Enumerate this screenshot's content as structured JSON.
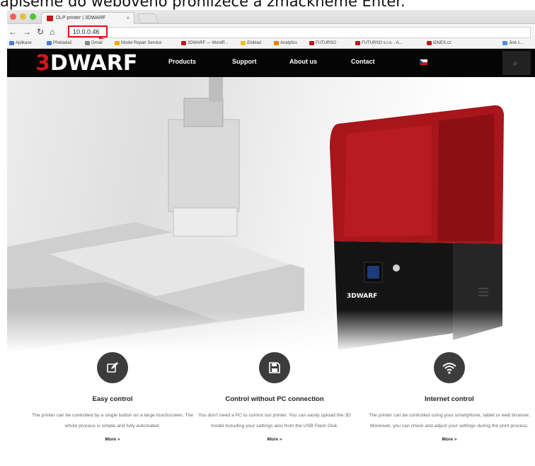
{
  "caption": "apíšeme do webového prohlížeče a zmáčkneme Enter.",
  "browser": {
    "tab_title": "DLP printer | 3DWARF",
    "tab_close": "×",
    "url": "10.0.0.46",
    "bookmarks": [
      {
        "label": "Aplikace",
        "color": "#4a7bd5"
      },
      {
        "label": "Překladač",
        "color": "#4a7bd5"
      },
      {
        "label": "Gmail",
        "color": "#888888"
      },
      {
        "label": "Model Repair Service",
        "color": "#f2a900"
      },
      {
        "label": "3DWARF — WordP...",
        "color": "#c0161c"
      },
      {
        "label": "iDoklad",
        "color": "#f0c419"
      },
      {
        "label": "Analytics",
        "color": "#f07d00"
      },
      {
        "label": "FUTURSO",
        "color": "#c0161c"
      },
      {
        "label": "FUTURSO s.r.o. - A...",
        "color": "#c0161c"
      },
      {
        "label": "iDNES.cz",
        "color": "#c0161c"
      },
      {
        "label": "Jiné z...",
        "color": "#4a90d9"
      }
    ]
  },
  "site": {
    "logo_prefix": "3",
    "logo_rest": "DWARF",
    "nav": [
      "Products",
      "Support",
      "About us",
      "Contact"
    ],
    "printer_label": "3DWARF",
    "colors": {
      "accent": "#d7131a",
      "nav_bg": "#050505"
    }
  },
  "features": [
    {
      "icon": "edit-icon",
      "title": "Easy control",
      "desc": "The printer can be controlled by a single button on a large touchscreen. The whole process is simple and fully automated.",
      "more": "More »"
    },
    {
      "icon": "floppy-disk-icon",
      "title": "Control without PC connection",
      "desc": "You don't need a PC to control our printer. You can easily upload the 3D model including your settings also from the USB Flash Disk.",
      "more": "More »"
    },
    {
      "icon": "wifi-icon",
      "title": "Internet control",
      "desc": "The printer can be controlled using your smartphone, tablet or web browser. Moreover, you can check and adjust your settings during the print process.",
      "more": "More »"
    }
  ]
}
